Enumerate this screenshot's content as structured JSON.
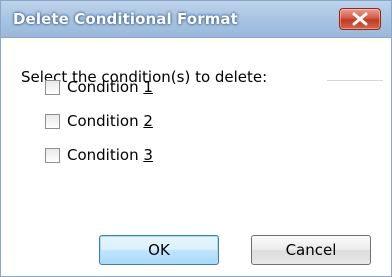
{
  "window": {
    "title": "Delete Conditional Format",
    "close_icon": "close-x-icon",
    "close_color": "#c23a22"
  },
  "prompt": "Select the condition(s) to delete:",
  "conditions": [
    {
      "label": "Condition ",
      "mnemonic": "1",
      "checked": false
    },
    {
      "label": "Condition ",
      "mnemonic": "2",
      "checked": false
    },
    {
      "label": "Condition ",
      "mnemonic": "3",
      "checked": false
    }
  ],
  "buttons": {
    "ok": "OK",
    "cancel": "Cancel"
  }
}
